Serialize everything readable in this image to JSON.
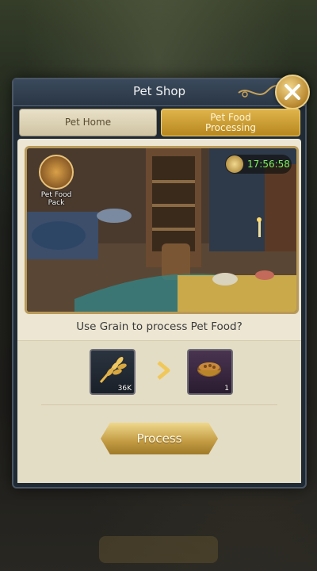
{
  "dialog": {
    "title": "Pet Shop",
    "tabs": [
      {
        "label": "Pet Home",
        "active": false
      },
      {
        "label": "Pet Food Processing",
        "active": true
      }
    ]
  },
  "scene": {
    "pack_label": "Pet Food Pack",
    "timer": "17:56:58"
  },
  "exchange": {
    "question": "Use Grain to process Pet Food?",
    "input": {
      "icon": "grain-icon",
      "count": "36K"
    },
    "output": {
      "icon": "pet-food-bowl-icon",
      "count": "1"
    },
    "button_label": "Process"
  },
  "colors": {
    "accent_gold": "#c29a42",
    "timer_green": "#7cf05a",
    "panel_bg": "#ece6d3",
    "header_bg": "#2a3644"
  }
}
